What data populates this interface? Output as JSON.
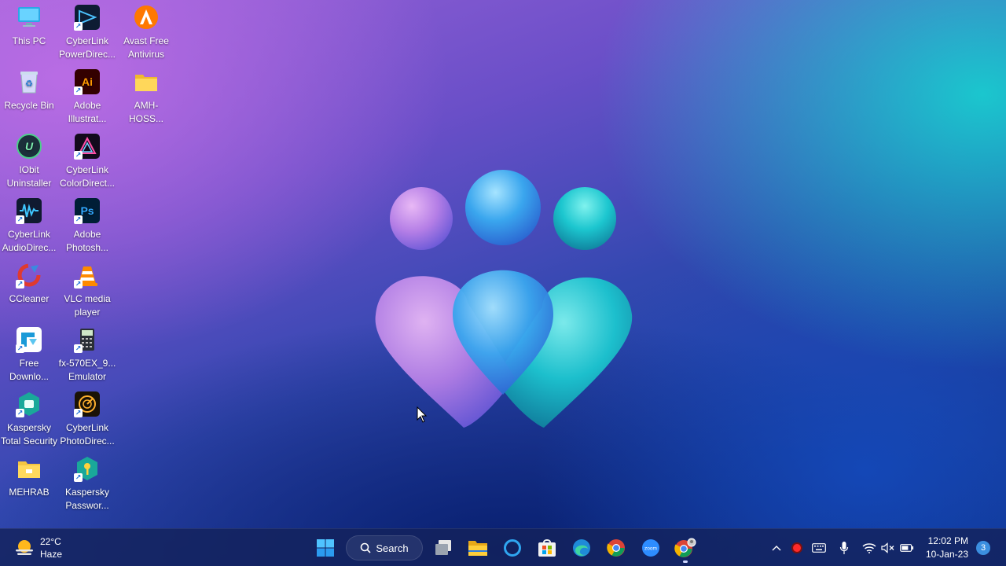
{
  "desktop": {
    "icons": [
      {
        "label": "This PC",
        "icon": "this-pc-icon"
      },
      {
        "label": "CyberLink\nPowerDirec...",
        "icon": "cyberlink-powerdirector-icon"
      },
      {
        "label": "Avast Free\nAntivirus",
        "icon": "avast-icon"
      },
      {
        "label": "Recycle Bin",
        "icon": "recycle-bin-icon"
      },
      {
        "label": "Adobe\nIllustrat...",
        "icon": "adobe-illustrator-icon",
        "glyph": "Ai"
      },
      {
        "label": "AMH-HOSS...",
        "icon": "folder-icon"
      },
      {
        "label": "IObit\nUninstaller",
        "icon": "iobit-uninstaller-icon"
      },
      {
        "label": "CyberLink\nColorDirect...",
        "icon": "cyberlink-colordirector-icon"
      },
      {
        "label": "CyberLink\nAudioDirec...",
        "icon": "cyberlink-audiodirector-icon"
      },
      {
        "label": "Adobe\nPhotosh...",
        "icon": "adobe-photoshop-icon",
        "glyph": "Ps"
      },
      {
        "label": "CCleaner",
        "icon": "ccleaner-icon"
      },
      {
        "label": "VLC media\nplayer",
        "icon": "vlc-icon"
      },
      {
        "label": "Free\nDownlo...",
        "icon": "free-download-manager-icon"
      },
      {
        "label": "fx-570EX_9...\nEmulator",
        "icon": "calculator-emulator-icon"
      },
      {
        "label": "Kaspersky\nTotal Security",
        "icon": "kaspersky-total-security-icon"
      },
      {
        "label": "CyberLink\nPhotoDirec...",
        "icon": "cyberlink-photodirector-icon"
      },
      {
        "label": "MEHRAB",
        "icon": "drive-folder-icon"
      },
      {
        "label": "Kaspersky\nPasswor...",
        "icon": "kaspersky-password-manager-icon"
      }
    ]
  },
  "taskbar": {
    "weather": {
      "temp": "22°C",
      "condition": "Haze",
      "icon": "weather-haze-icon"
    },
    "start_icon": "windows-start-icon",
    "search_label": "Search",
    "apps": [
      "task-view-icon",
      "file-explorer-icon",
      "cortana-icon",
      "microsoft-store-icon",
      "edge-icon",
      "chrome-icon",
      "zoom-icon",
      "chrome-profile-icon"
    ],
    "tray": [
      "chevron-up-icon",
      "record-icon",
      "keyboard-icon",
      "microphone-icon",
      "wifi-icon",
      "volume-muted-icon",
      "battery-icon"
    ],
    "clock": {
      "time": "12:02 PM",
      "date": "10-Jan-23"
    },
    "notifications": "3"
  },
  "colors": {
    "accent": "#3b8fe0",
    "taskbar": "#14225c"
  }
}
